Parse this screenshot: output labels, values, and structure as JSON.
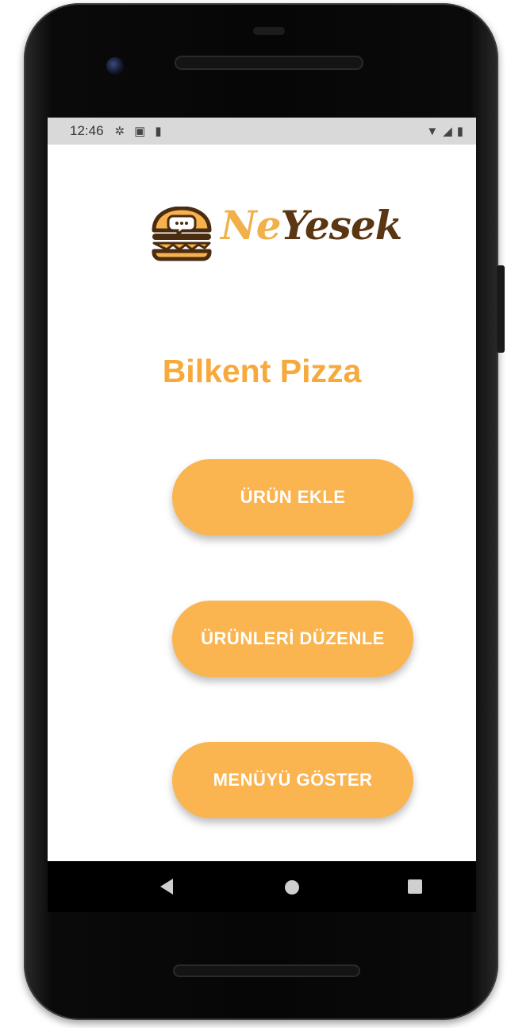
{
  "status_bar": {
    "time": "12:46",
    "left_icons": [
      "gear-icon",
      "a-icon",
      "sd-card-icon"
    ],
    "right_icons": [
      "wifi-icon",
      "signal-icon",
      "battery-icon"
    ]
  },
  "logo": {
    "part1": "Ne",
    "part2": "Yesek",
    "brand_colors": {
      "accent": "#f0b04a",
      "dark": "#5a3612"
    }
  },
  "restaurant": {
    "title": "Bilkent Pizza",
    "title_color": "#f7a93b"
  },
  "buttons": {
    "add_product": "ÜRÜN EKLE",
    "edit_products": "ÜRÜNLERİ DÜZENLE",
    "show_menu": "MENÜYÜ GÖSTER",
    "color": "#fab450"
  },
  "nav_bar": {
    "icons": [
      "back-icon",
      "home-icon",
      "recents-icon"
    ]
  }
}
